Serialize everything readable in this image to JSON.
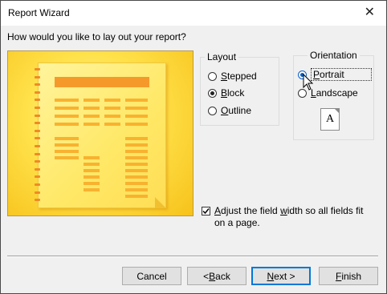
{
  "window": {
    "title": "Report Wizard",
    "close_icon": "close-icon"
  },
  "question": "How would you like to lay out your report?",
  "layout": {
    "label": "Layout",
    "options": [
      {
        "pre": "",
        "key": "S",
        "post": "tepped",
        "selected": false
      },
      {
        "pre": "",
        "key": "B",
        "post": "lock",
        "selected": true
      },
      {
        "pre": "",
        "key": "O",
        "post": "utline",
        "selected": false
      }
    ]
  },
  "orientation": {
    "label": "Orientation",
    "options": [
      {
        "pre": "",
        "key": "P",
        "post": "ortrait",
        "selected": true
      },
      {
        "pre": "",
        "key": "L",
        "post": "andscape",
        "selected": false
      }
    ],
    "preview_letter": "A"
  },
  "adjust": {
    "checked": true,
    "pre": "",
    "key": "A",
    "mid": "djust the field ",
    "key2": "w",
    "post": "idth so all fields fit on a page."
  },
  "buttons": {
    "cancel": "Cancel",
    "back_pre": "< ",
    "back_key": "B",
    "back_post": "ack",
    "next_key": "N",
    "next_post": "ext >",
    "finish_key": "F",
    "finish_post": "inish"
  },
  "colors": {
    "preview_bg": "#ffe14a",
    "preview_header": "#f59a2a",
    "accent_blue": "#0078d7"
  }
}
